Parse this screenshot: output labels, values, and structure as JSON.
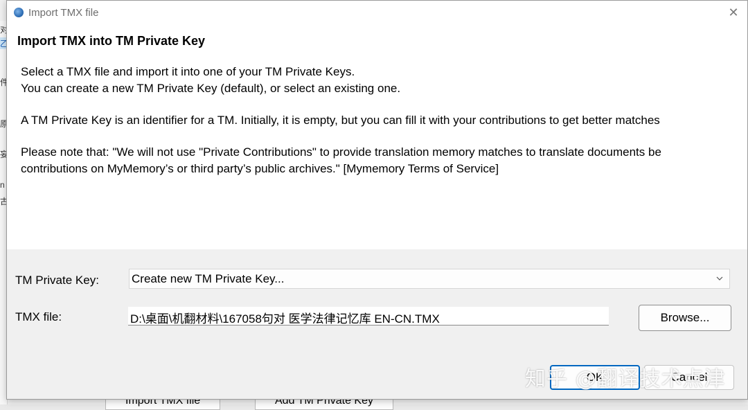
{
  "background": {
    "side_chars": [
      "对",
      "乙",
      "件",
      "原",
      "妄",
      "n",
      "古"
    ],
    "buttons": [
      "Import TMX file",
      "Add TM Private Key"
    ]
  },
  "dialog": {
    "title": "Import TMX file",
    "close_glyph": "✕",
    "heading": "Import TMX into TM Private Key",
    "paragraphs": [
      "Select a TMX file and import it into one of your TM Private Keys.",
      "You can create a new TM Private Key (default), or select an existing one.",
      "A TM Private Key is an identifier for a TM. Initially, it is empty, but you can fill it with your contributions to get better matches",
      "Please note that: \"We will not use \"Private Contributions\" to provide translation memory matches to translate documents be",
      "contributions on MyMemory’s or third party’s public archives.\" [Mymemory Terms of Service]"
    ],
    "tm_key_label": "TM Private Key:",
    "tm_key_selected": "Create new TM Private Key...",
    "tmx_file_label": "TMX file:",
    "tmx_file_value": "D:\\桌面\\机翻材料\\167058句对 医学法律记忆库 EN-CN.TMX",
    "browse_label": "Browse...",
    "ok_label": "OK",
    "cancel_label": "Cancel"
  },
  "watermark": "知乎 @翻译技术点津",
  "icons": {
    "app": "globe-icon",
    "close": "close-icon",
    "dropdown": "chevron-down-icon"
  },
  "colors": {
    "accent": "#0067c0",
    "content_bg": "#ffffff",
    "dialog_bg": "#f0f0f0"
  }
}
